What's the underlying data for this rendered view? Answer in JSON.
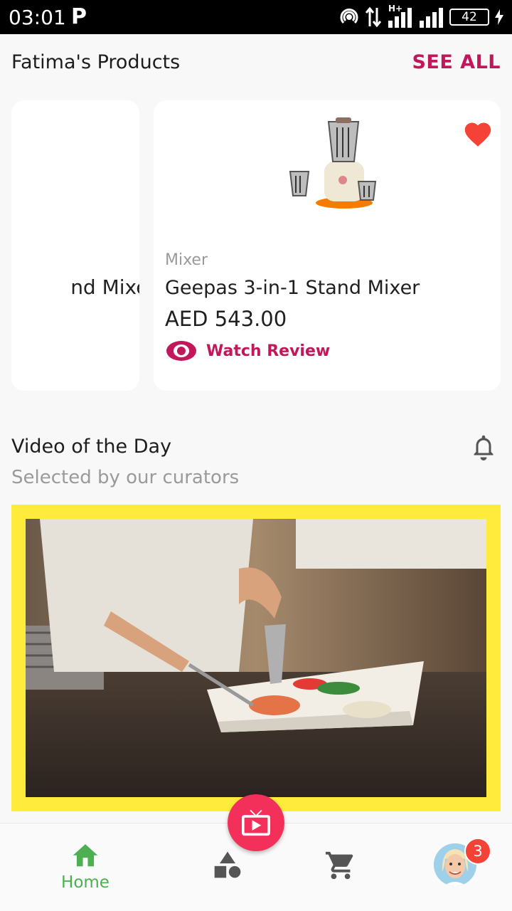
{
  "status_bar": {
    "time": "03:01",
    "carrier_icon": "P",
    "network": "H+",
    "battery": "42"
  },
  "products_section": {
    "title": "Fatima's Products",
    "see_all": "SEE ALL",
    "cards": [
      {
        "partial_name": "nd Mixer"
      },
      {
        "category": "Mixer",
        "name": "Geepas 3-in-1 Stand Mixer",
        "price": "AED 543.00",
        "watch_review": "Watch Review",
        "favorite": true
      }
    ]
  },
  "video_section": {
    "title": "Video of the Day",
    "subtitle": "Selected by our curators"
  },
  "bottom_nav": {
    "home_label": "Home",
    "badge_count": "3"
  },
  "colors": {
    "accent_pink": "#c2185b",
    "fab_pink": "#f2305a",
    "home_green": "#4caf50",
    "video_border_yellow": "#ffeb3b",
    "favorite_red": "#f44336"
  },
  "icons": [
    "wifi-hotspot-icon",
    "data-arrows-icon",
    "signal-icon",
    "battery-icon",
    "heart-icon",
    "eye-icon",
    "bell-icon",
    "home-icon",
    "shapes-icon",
    "cart-icon",
    "tv-icon"
  ]
}
